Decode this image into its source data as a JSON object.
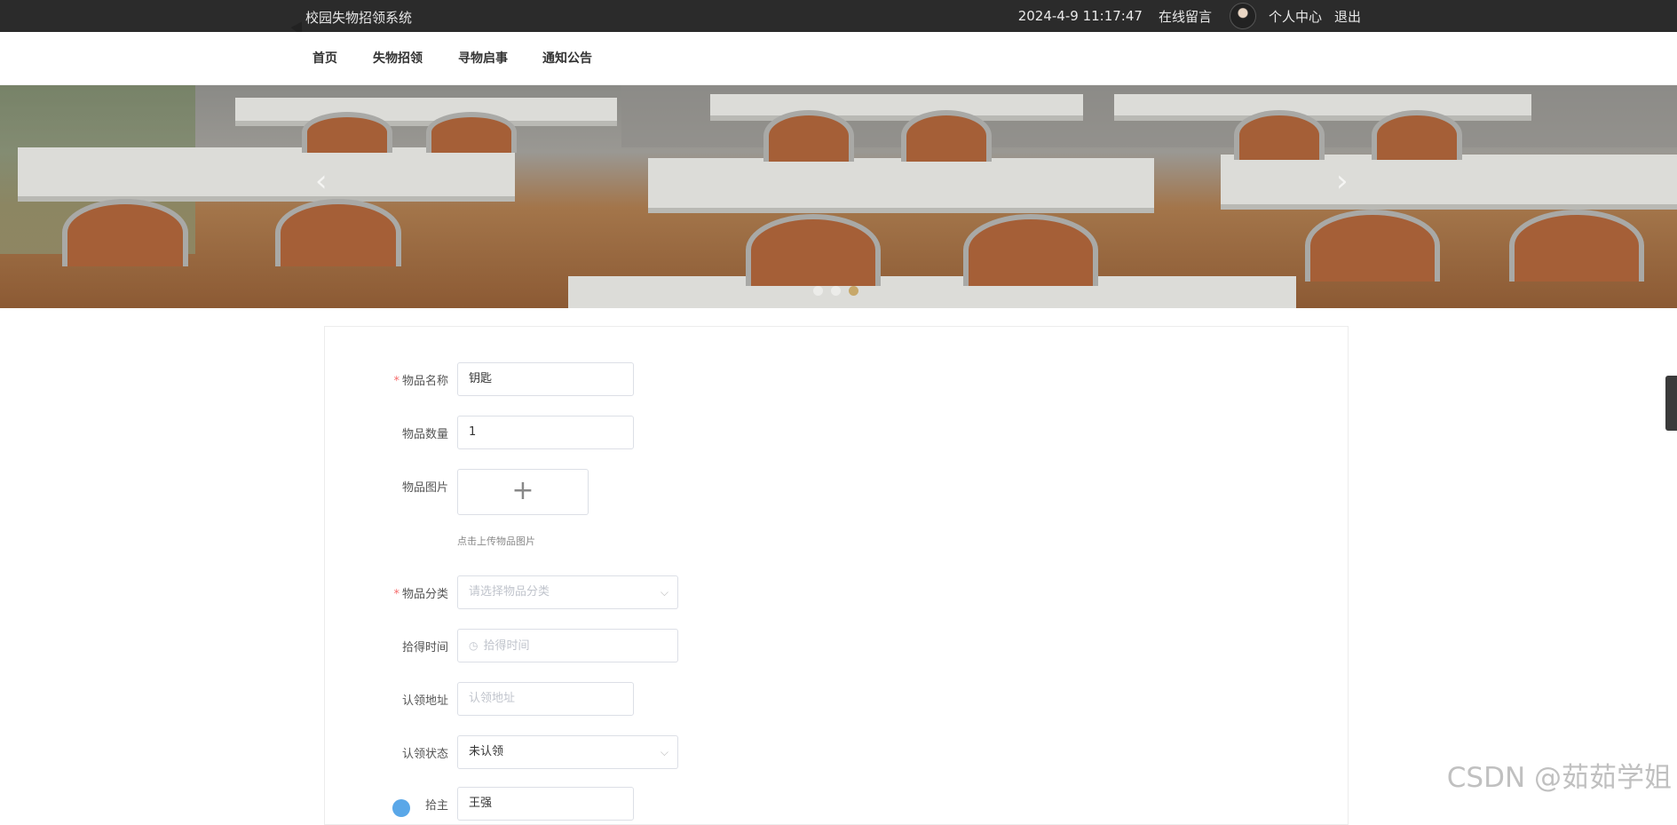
{
  "topbar": {
    "site_title": "校园失物招领系统",
    "datetime": "2024-4-9 11:17:47",
    "messages": "在线留言",
    "profile": "个人中心",
    "logout": "退出"
  },
  "nav": {
    "items": [
      "首页",
      "失物招领",
      "寻物启事",
      "通知公告"
    ]
  },
  "banner": {
    "slide_count": 3,
    "active_slide": 3
  },
  "form": {
    "item_name": {
      "label": "物品名称",
      "required": true,
      "value": "钥匙"
    },
    "item_quantity": {
      "label": "物品数量",
      "value": "1"
    },
    "item_image": {
      "label": "物品图片",
      "plus": "+",
      "tip": "点击上传物品图片"
    },
    "item_category": {
      "label": "物品分类",
      "required": true,
      "placeholder": "请选择物品分类"
    },
    "found_time": {
      "label": "拾得时间",
      "placeholder": "拾得时间"
    },
    "claim_address": {
      "label": "认领地址",
      "placeholder": "认领地址"
    },
    "claim_status": {
      "label": "认领状态",
      "value": "未认领"
    },
    "finder": {
      "label": "拾主",
      "value": "王强"
    }
  },
  "watermark": "CSDN @茹茹学姐",
  "colors": {
    "topbar_bg": "#2b2b2b",
    "required": "#f56c6c",
    "active_dot": "#c7a86a"
  }
}
